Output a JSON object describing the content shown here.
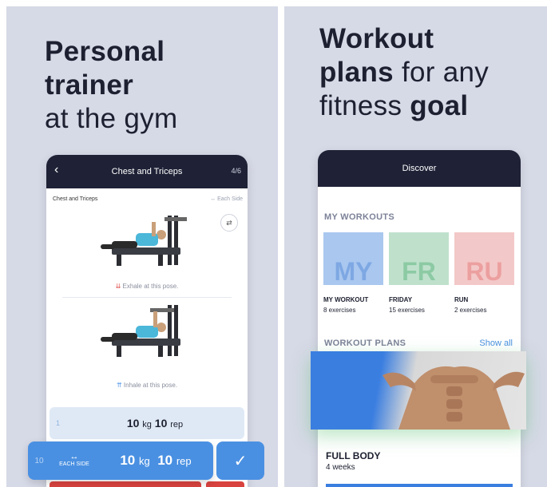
{
  "left": {
    "headline": {
      "bold_line1": "Personal",
      "bold_line2": "trainer",
      "light_line3": "at the gym"
    },
    "screen": {
      "nav_title": "Chest and Triceps",
      "counter": "4/6",
      "exercise_label": "Chest and Triceps",
      "each_side_label": "Each Side",
      "exhale_note": "Exhale at this pose.",
      "inhale_note": "Inhale at this pose.",
      "set_row": {
        "number": "1",
        "weight": "10",
        "weight_unit": "kg",
        "reps": "10",
        "reps_unit": "rep"
      }
    },
    "active_set": {
      "number": "10",
      "side_label": "EACH SIDE",
      "weight": "10",
      "weight_unit": "kg",
      "reps": "10",
      "reps_unit": "rep"
    }
  },
  "right": {
    "headline": {
      "bold_line1": "Workout",
      "bold_word2": "plans",
      "light_rest2": "for any",
      "light_word3": "fitness",
      "bold_word3": "goal"
    },
    "screen": {
      "nav_title": "Discover",
      "my_workouts_title": "MY WORKOUTS",
      "workouts": [
        {
          "initials": "MY",
          "name": "MY WORKOUT",
          "sub": "8 exercises",
          "bg": "#a9c7ef",
          "fg": "#7ea8e3"
        },
        {
          "initials": "FR",
          "name": "FRIDAY",
          "sub": "15 exercises",
          "bg": "#bfe1cc",
          "fg": "#8ccaa4"
        },
        {
          "initials": "RU",
          "name": "RUN",
          "sub": "2 exercises",
          "bg": "#f3c8c8",
          "fg": "#ec9f9f"
        }
      ],
      "plans_title": "WORKOUT PLANS",
      "show_all": "Show all",
      "plan": {
        "title": "FULL BODY",
        "sub": "4 weeks"
      }
    }
  },
  "colors": {
    "accent": "#4a90e2",
    "nav": "#1f2236",
    "panel_bg": "#d6d9e6",
    "alert": "#d9433f"
  }
}
